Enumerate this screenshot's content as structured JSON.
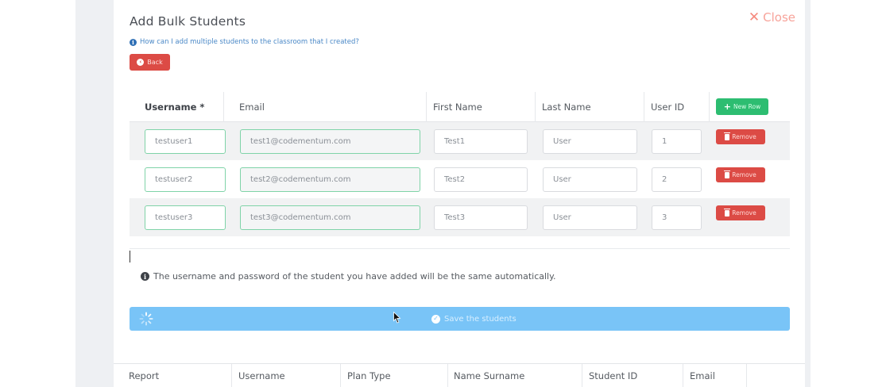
{
  "modal": {
    "title": "Add Bulk Students",
    "close_label": "Close",
    "help_link": "How can I add multiple students to the classroom that I created?",
    "back_label": "Back"
  },
  "table": {
    "headers": {
      "username": "Username *",
      "email": "Email",
      "first_name": "First Name",
      "last_name": "Last Name",
      "user_id": "User ID"
    },
    "new_row_label": "New Row",
    "remove_label": "Remove",
    "rows": [
      {
        "username": "testuser1",
        "email": "test1@codementum.com",
        "first_name": "Test1",
        "last_name": "User",
        "user_id": "1"
      },
      {
        "username": "testuser2",
        "email": "test2@codementum.com",
        "first_name": "Test2",
        "last_name": "User",
        "user_id": "2"
      },
      {
        "username": "testuser3",
        "email": "test3@codementum.com",
        "first_name": "Test3",
        "last_name": "User",
        "user_id": "3"
      }
    ]
  },
  "note": "The username and password of the student you have added will be the same automatically.",
  "save_label": "Save the students",
  "bottom_table": {
    "headers": [
      "Report",
      "Username",
      "Plan Type",
      "Name Surname",
      "Student ID",
      "Email"
    ]
  },
  "icons": {
    "close": "close-icon",
    "help": "info-icon",
    "back": "arrow-left-circle-icon",
    "new_row": "plus-icon",
    "remove": "trash-icon",
    "spinner": "loading-spinner-icon",
    "save": "check-circle-icon"
  },
  "colors": {
    "danger": "#dc4b45",
    "success": "#2dbd71",
    "save_bar": "#79c4f7",
    "close": "#f5897d",
    "link": "#4a88c7",
    "valid_border": "#7fd3a8"
  }
}
